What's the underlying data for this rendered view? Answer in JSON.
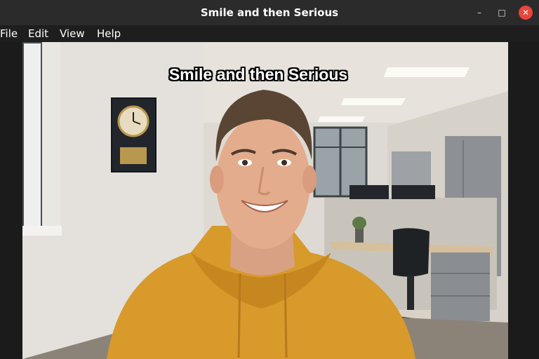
{
  "window": {
    "title": "Smile and then Serious",
    "minimize_glyph": "–",
    "maximize_glyph": "□",
    "close_glyph": "✕"
  },
  "menu": {
    "file": "File",
    "edit": "Edit",
    "view": "View",
    "help": "Help"
  },
  "video": {
    "caption": "Smile and then Serious"
  },
  "colors": {
    "titlebar": "#2b2b2b",
    "close_button": "#e8453c",
    "hoodie": "#d79a2b"
  }
}
